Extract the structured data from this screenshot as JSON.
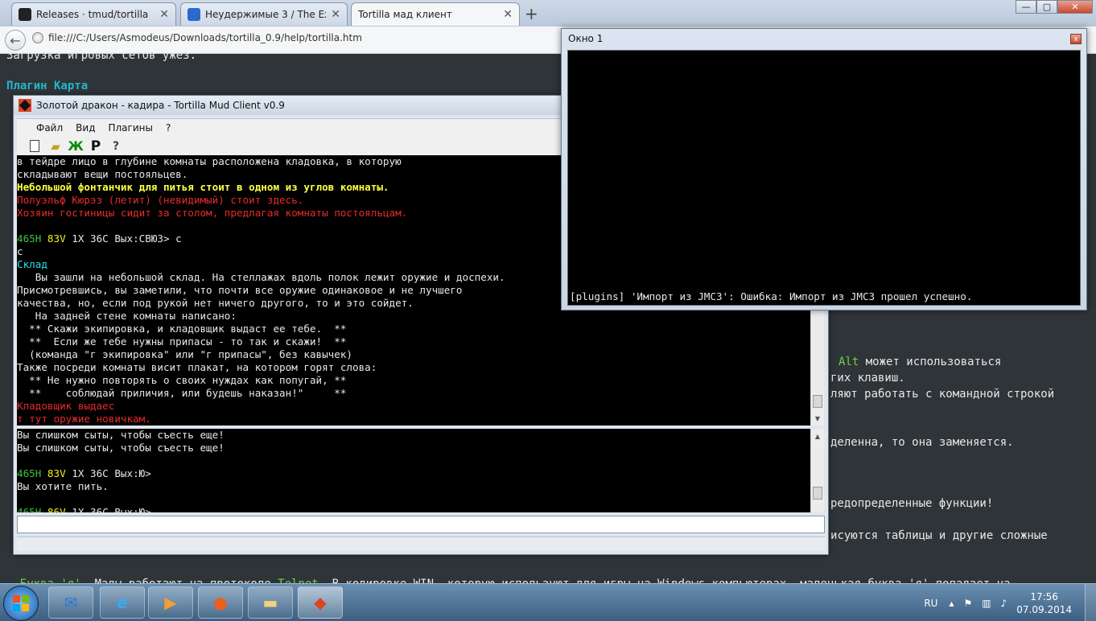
{
  "browser": {
    "tabs": [
      {
        "title": "Releases · tmud/tortilla",
        "favicon_color": "#222222",
        "icon": "github-icon"
      },
      {
        "title": "Неудержимые 3 / The Exp…",
        "favicon_color": "#2a6acb",
        "icon": "site-icon"
      },
      {
        "title": "Tortilla мад клиент",
        "favicon_color": "#ffffff",
        "icon": "blank-page-icon"
      }
    ],
    "new_tab": "+",
    "url": "file:///C:/Users/Asmodeus/Downloads/tortilla_0.9/help/tortilla.htm",
    "window_controls": {
      "minimize": "—",
      "maximize": "▢",
      "close": "✕"
    }
  },
  "help_page": {
    "top_text": "Загрузка игровых сетов ужез.",
    "heading": "Плагин Карта",
    "right_lines": [
      {
        "prefix": "",
        "highlight": "Alt",
        "text": " может использоваться"
      },
      {
        "prefix": "",
        "highlight": "",
        "text": "гих клавиш."
      },
      {
        "prefix": "",
        "highlight": "",
        "text": "ляют работать с командной строкой"
      },
      {
        "prefix": "",
        "highlight": "",
        "text": "деленна, то она заменяется."
      },
      {
        "prefix": "",
        "highlight": "",
        "text": "редопределенные функции!"
      },
      {
        "prefix": "",
        "highlight": "",
        "text": "исуются таблицы и другие сложные"
      }
    ],
    "bottom_line": {
      "lead": "- ",
      "bukva": "Буква 'я'",
      "mid": ". Мады работают на протоколе ",
      "telnet": "Telnet",
      "rest": ". В кодировке WIN, которую используют для игры на Windows-компьютерах, маленькая буква 'я' попадает на"
    }
  },
  "main_window": {
    "title": "Золотой дракон - кадира - Tortilla Mud Client v0.9",
    "menu": [
      "Файл",
      "Вид",
      "Плагины",
      "?"
    ],
    "toolbar": [
      "new-file-icon",
      "open-folder-icon",
      "green-star-icon",
      "p-letter-icon",
      "help-icon"
    ],
    "output_lines": [
      [
        {
          "c": "c-w",
          "t": "в тейдре лицо в глубине комнаты расположена кладовка, в которую"
        }
      ],
      [
        {
          "c": "c-w",
          "t": "складывают вещи постояльцев."
        }
      ],
      [
        {
          "c": "c-b",
          "t": "Небольшой фонтанчик для питья стоит в одном из углов комнаты."
        }
      ],
      [
        {
          "c": "c-r",
          "t": "Полуэльф Кюрэз (летит) (невидимый) стоит здесь."
        }
      ],
      [
        {
          "c": "c-r",
          "t": "Хозяин гостиницы сидит за столом, предлагая комнаты постояльцам."
        }
      ],
      [
        {
          "c": "c-w",
          "t": ""
        }
      ],
      [
        {
          "c": "c-g",
          "t": "465H "
        },
        {
          "c": "c-y",
          "t": "83V "
        },
        {
          "c": "c-w",
          "t": "1X 36C Вых:СВЮЗ> с"
        }
      ],
      [
        {
          "c": "c-w",
          "t": "с"
        }
      ],
      [
        {
          "c": "c-c",
          "t": "Склад"
        }
      ],
      [
        {
          "c": "c-w",
          "t": "   Вы зашли на небольшой склад. На стеллажах вдоль полок лежит оружие и доспехи."
        }
      ],
      [
        {
          "c": "c-w",
          "t": "Присмотревшись, вы заметили, что почти все оружие одинаковое и не лучшего"
        }
      ],
      [
        {
          "c": "c-w",
          "t": "качества, но, если под рукой нет ничего другого, то и это сойдет."
        }
      ],
      [
        {
          "c": "c-w",
          "t": "   На задней стене комнаты написано:"
        }
      ],
      [
        {
          "c": "c-w",
          "t": "  ** Скажи экипировка, и кладовщик выдаст ее тебе.  **"
        }
      ],
      [
        {
          "c": "c-w",
          "t": "  **  Если же тебе нужны припасы - то так и скажи!  **"
        }
      ],
      [
        {
          "c": "c-w",
          "t": "  (команда \"г экипировка\" или \"г припасы\", без кавычек)"
        }
      ],
      [
        {
          "c": "c-w",
          "t": "Также посреди комнаты висит плакат, на котором горят слова:"
        }
      ],
      [
        {
          "c": "c-w",
          "t": "  ** Не нужно повторять о своих нуждах как попугай, **"
        }
      ],
      [
        {
          "c": "c-w",
          "t": "  **    соблюдай приличия, или будешь наказан!\"     **"
        }
      ],
      [
        {
          "c": "c-r",
          "t": "Кладовщик выдаес"
        }
      ],
      [
        {
          "c": "c-r",
          "t": "т тут оружие новичкам."
        }
      ]
    ],
    "lower_lines": [
      [
        {
          "c": "c-w",
          "t": "Вы слишком сыты, чтобы съесть еще!"
        }
      ],
      [
        {
          "c": "c-w",
          "t": "Вы слишком сыты, чтобы съесть еще!"
        }
      ],
      [
        {
          "c": "c-w",
          "t": ""
        }
      ],
      [
        {
          "c": "c-g",
          "t": "465H "
        },
        {
          "c": "c-y",
          "t": "83V "
        },
        {
          "c": "c-w",
          "t": "1X 36C Вых:Ю>"
        }
      ],
      [
        {
          "c": "c-w",
          "t": "Вы хотите пить."
        }
      ],
      [
        {
          "c": "c-w",
          "t": ""
        }
      ],
      [
        {
          "c": "c-g",
          "t": "465H "
        },
        {
          "c": "c-y",
          "t": "86V "
        },
        {
          "c": "c-w",
          "t": "1X 36C Вых:Ю>"
        }
      ]
    ],
    "input_value": ""
  },
  "window1": {
    "title": "Окно 1",
    "close": "x",
    "line": "[plugins] 'Импорт из JMC3': Ошибка: Импорт из JMC3 прошел успешно."
  },
  "taskbar": {
    "apps": [
      "thunderbird-icon",
      "ie-icon",
      "media-player-icon",
      "firefox-icon",
      "explorer-folder-icon",
      "tortilla-icon"
    ],
    "lang": "RU",
    "time": "17:56",
    "date": "07.09.2014"
  }
}
